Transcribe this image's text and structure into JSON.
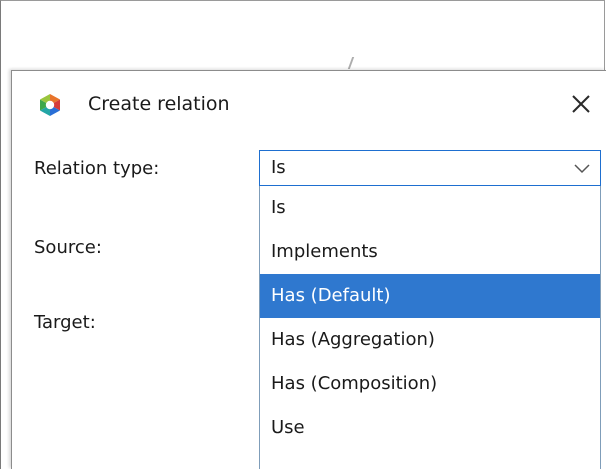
{
  "dialog": {
    "title": "Create relation",
    "icon": "app-logo-icon",
    "close_icon": "close-icon"
  },
  "form": {
    "relation_type_label": "Relation type:",
    "source_label": "Source:",
    "target_label": "Target:",
    "relation_type_value": "Is"
  },
  "dropdown": {
    "options": [
      {
        "label": "Is",
        "selected": false
      },
      {
        "label": "Implements",
        "selected": false
      },
      {
        "label": "Has (Default)",
        "selected": true
      },
      {
        "label": "Has (Aggregation)",
        "selected": false
      },
      {
        "label": "Has (Composition)",
        "selected": false
      },
      {
        "label": "Use",
        "selected": false
      }
    ]
  },
  "colors": {
    "highlight": "#2f78cf",
    "focus_border": "#1e6fd0",
    "icon_green": "#3da84a",
    "icon_blue": "#2a6fd6",
    "icon_orange": "#e8742b",
    "icon_teal": "#24a6a6",
    "icon_red": "#d63b3b"
  }
}
